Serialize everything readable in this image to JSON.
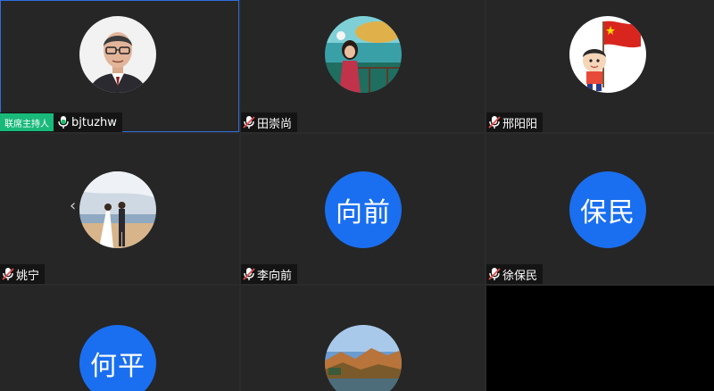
{
  "participants": [
    {
      "name": "bjtuzhw",
      "host_label": "联席主持人",
      "mic": "mic-active",
      "avatar": "photo-man-glasses"
    },
    {
      "name": "田崇尚",
      "mic": "mic-muted",
      "avatar": "photo-woman-by-sea"
    },
    {
      "name": "邢阳阳",
      "mic": "mic-muted",
      "avatar": "cartoon-boy-with-flag"
    },
    {
      "name": "姚宁",
      "mic": "mic-muted",
      "avatar": "photo-wedding-beach"
    },
    {
      "name": "李向前",
      "mic": "mic-muted",
      "avatar_text": "向前"
    },
    {
      "name": "徐保民",
      "mic": "mic-muted",
      "avatar_text": "保民"
    },
    {
      "name": "",
      "mic": "",
      "avatar_text": "何平"
    },
    {
      "name": "",
      "mic": "",
      "avatar": "photo-autumn-landscape"
    }
  ],
  "colors": {
    "host_badge": "#19b97a",
    "initials_bg": "#1a6ff0",
    "active_border": "#2f6fe0"
  },
  "nav": {
    "prev_icon": "chevron-left-icon"
  }
}
